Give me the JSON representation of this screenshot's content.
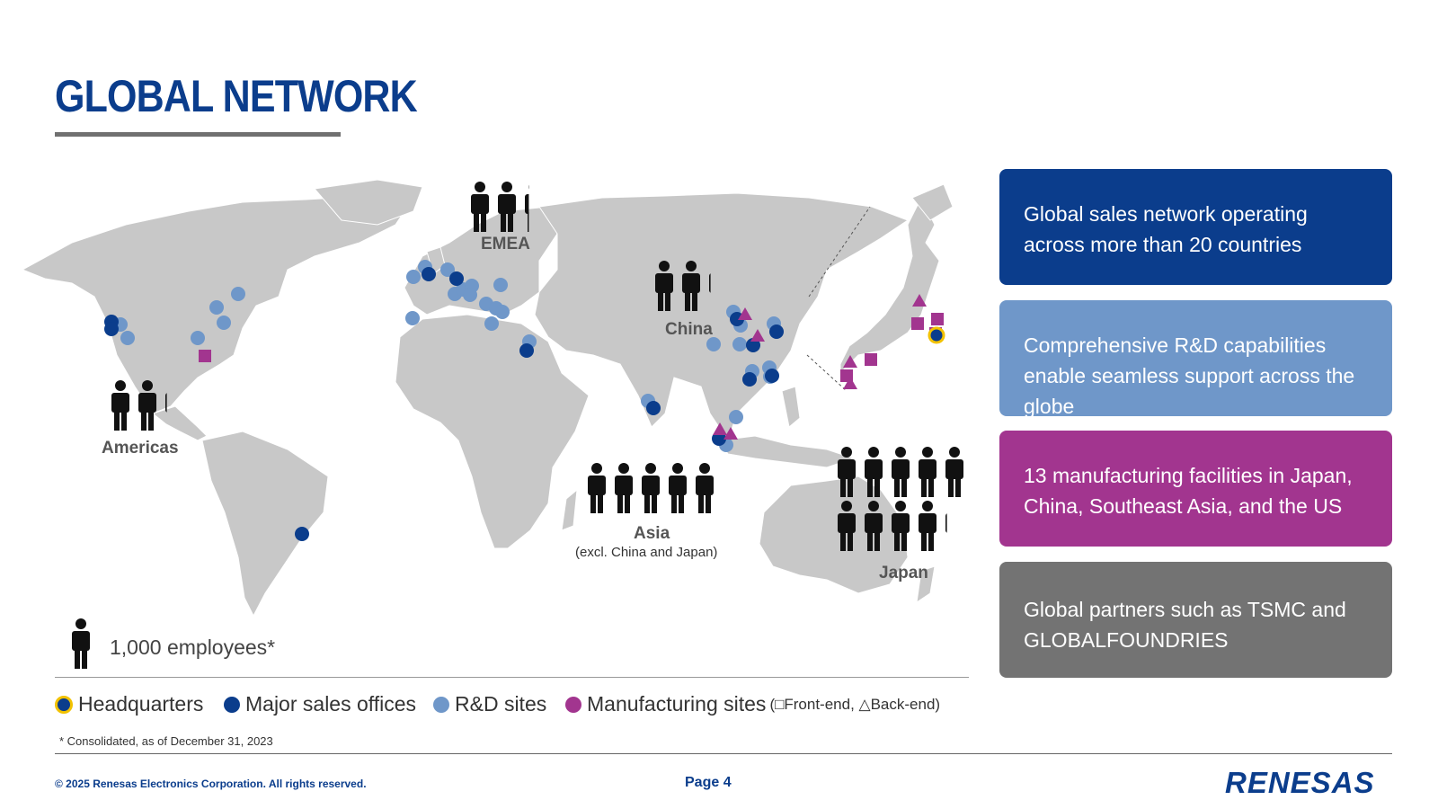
{
  "page": {
    "title": "GLOBAL NETWORK",
    "footnote": "* Consolidated, as of December 31, 2023",
    "copyright": "© 2025 Renesas Electronics Corporation. All rights reserved.",
    "page_number": "Page 4",
    "logo_text": "RENESAS"
  },
  "map": {
    "regions": [
      {
        "label": "EMEA",
        "employees_thousands": 2.3
      },
      {
        "label": "China",
        "employees_thousands": 2.2
      },
      {
        "label": "Americas",
        "employees_thousands": 2.2
      },
      {
        "label": "Asia",
        "sublabel": "(excl. China and Japan)",
        "employees_thousands": 5
      },
      {
        "label": "Japan",
        "employees_thousands": 9.2
      }
    ],
    "employee_legend": "1,000 employees*"
  },
  "legend": {
    "headquarters": "Headquarters",
    "sales": "Major sales offices",
    "rnd": "R&D sites",
    "manufacturing": "Manufacturing sites",
    "manufacturing_note": "(□Front-end, △Back-end)"
  },
  "cards": [
    {
      "text": "Global sales network operating across more than 20 countries",
      "color": "#0b3d8c"
    },
    {
      "text": "Comprehensive R&D capabilities enable seamless support across the globe",
      "color": "#6f97c9"
    },
    {
      "text": "13 manufacturing facilities in Japan, China, Southeast Asia, and the US",
      "color": "#a2358f"
    },
    {
      "text": "Global partners such as TSMC and GLOBALFOUNDRIES",
      "color": "#737373"
    }
  ],
  "colors": {
    "brand": "#0b3d8c",
    "headquarters_ring": "#f2c200",
    "sales": "#0b3d8c",
    "rnd": "#6f97c9",
    "manufacturing": "#a2358f",
    "land": "#c8c8c8"
  }
}
